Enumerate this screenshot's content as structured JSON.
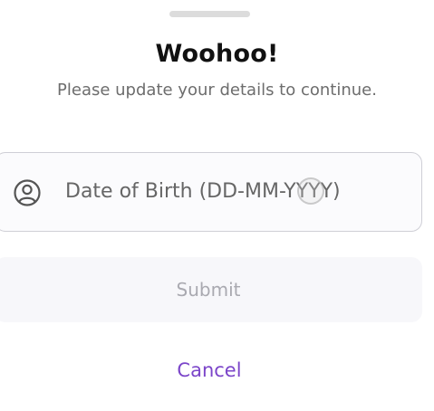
{
  "dialog": {
    "title": "Woohoo!",
    "subtitle": "Please update your details to continue."
  },
  "dob_field": {
    "icon": "user-circle-icon",
    "placeholder": "Date of Birth (DD-MM-YYYY)"
  },
  "actions": {
    "submit_label": "Submit",
    "cancel_label": "Cancel"
  },
  "colors": {
    "accent": "#7b45c9",
    "disabled_text": "#a9a9b0",
    "field_border": "#cfcfd6"
  }
}
